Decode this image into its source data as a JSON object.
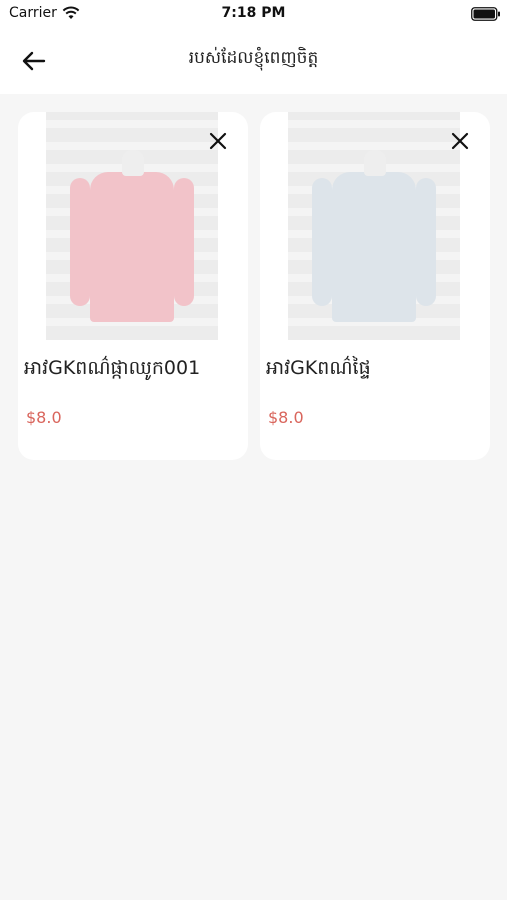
{
  "status_bar": {
    "carrier": "Carrier",
    "time": "7:18 PM",
    "icons": [
      "wifi-icon",
      "battery-icon"
    ]
  },
  "header": {
    "back_icon": "arrow-left-icon",
    "title": "របស់ដែលខ្ញុំពេញចិត្ត"
  },
  "favorites": [
    {
      "name": "អាវGKពណ៌ផ្កាឈូក001",
      "price": "$8.0",
      "shirt_color": "#f2c3c9",
      "remove_icon": "close-icon"
    },
    {
      "name": "អាវGKពណ៌ផ្ទៃ",
      "price": "$8.0",
      "shirt_color": "#dde4ea",
      "remove_icon": "close-icon"
    }
  ],
  "colors": {
    "price": "#d9655c",
    "background": "#f6f6f6",
    "card": "#ffffff"
  }
}
